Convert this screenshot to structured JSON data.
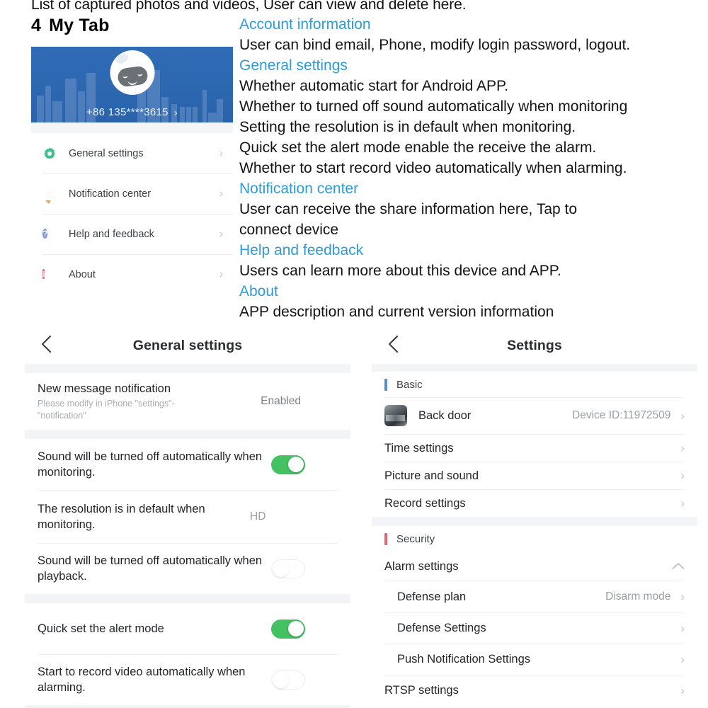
{
  "top_truncated_line": "List of captured photos and videos, User can view and delete here.",
  "section": {
    "number": "4",
    "title": "My Tab"
  },
  "phone_mock": {
    "account_phone": "+86 135****3615",
    "chevron": "›",
    "avatar_icon": "robot-avatar-icon",
    "menu": [
      {
        "label": "General settings",
        "icon": "gear-icon",
        "icon_color": "#3fbf8f",
        "chevron": "›"
      },
      {
        "label": "Notification center",
        "icon": "bubble-icon",
        "icon_color": "#f0a35c",
        "chevron": "›"
      },
      {
        "label": "Help and feedback",
        "icon": "question-icon",
        "icon_color": "#7e8fe0",
        "glyph": "?",
        "chevron": "›"
      },
      {
        "label": "About",
        "icon": "info-icon",
        "icon_color": "#ef6b78",
        "glyph": "i",
        "chevron": "›"
      }
    ]
  },
  "descriptions": [
    {
      "heading": "Account information",
      "lines": [
        "User can bind email, Phone, modify login password, logout."
      ]
    },
    {
      "heading": "General settings",
      "lines": [
        "Whether automatic start for Android APP.",
        "Whether to turned off sound automatically when monitoring",
        "Setting the resolution is in default when monitoring.",
        "Quick set the alert mode enable the receive the alarm.",
        "Whether to start record video automatically when alarming."
      ]
    },
    {
      "heading": "Notification center",
      "lines": [
        "User can receive the share information here, Tap to connect device"
      ]
    },
    {
      "heading": "Help and feedback",
      "lines": [
        "Users can learn more about this device and APP."
      ]
    },
    {
      "heading": "About",
      "lines": [
        "APP description and current version information"
      ]
    }
  ],
  "general_settings_screen": {
    "title": "General settings",
    "back_icon": "chevron-left-icon",
    "rows": [
      {
        "title": "New message notification",
        "sub": "Please modify in iPhone \"settings\"-\"notification\"",
        "value": "Enabled",
        "control": "value"
      },
      {
        "title": "Sound will be turned off automatically when monitoring.",
        "control": "toggle",
        "toggle_state": "on"
      },
      {
        "title": "The resolution is in default when monitoring.",
        "value": "HD",
        "control": "value"
      },
      {
        "title": "Sound will be turned off automatically when playback.",
        "control": "toggle",
        "toggle_state": "off"
      },
      {
        "title": "Quick set the alert mode",
        "control": "toggle",
        "toggle_state": "on"
      },
      {
        "title": "Start to record video automatically when alarming.",
        "control": "toggle",
        "toggle_state": "off"
      }
    ]
  },
  "settings_screen": {
    "title": "Settings",
    "back_icon": "chevron-left-icon",
    "groups": [
      {
        "label": "Basic",
        "accent": "#5b8ad4",
        "rows": [
          {
            "title": "Back door",
            "value": "Device ID:11972509",
            "thumb": true,
            "chevron": "›"
          },
          {
            "title": "Time settings",
            "chevron": "›"
          },
          {
            "title": "Picture and sound",
            "chevron": "›"
          },
          {
            "title": "Record settings",
            "chevron": "›"
          }
        ]
      },
      {
        "label": "Security",
        "accent": "#e8646f",
        "rows": [
          {
            "title": "Alarm settings",
            "expand_icon": "chevron-up-icon"
          },
          {
            "title": "Defense plan",
            "value": "Disarm mode",
            "indent": true,
            "chevron": "›"
          },
          {
            "title": "Defense Settings",
            "indent": true,
            "chevron": "›"
          },
          {
            "title": "Push Notification Settings",
            "indent": true,
            "chevron": "›"
          },
          {
            "title": "RTSP settings",
            "chevron": "›"
          }
        ]
      }
    ]
  },
  "colors": {
    "heading_blue": "#2e9ad6",
    "toggle_on_green": "#44c263",
    "banner_blue": "#2f6cb5",
    "basic_accent": "#5b8ad4",
    "security_accent": "#e8646f"
  }
}
